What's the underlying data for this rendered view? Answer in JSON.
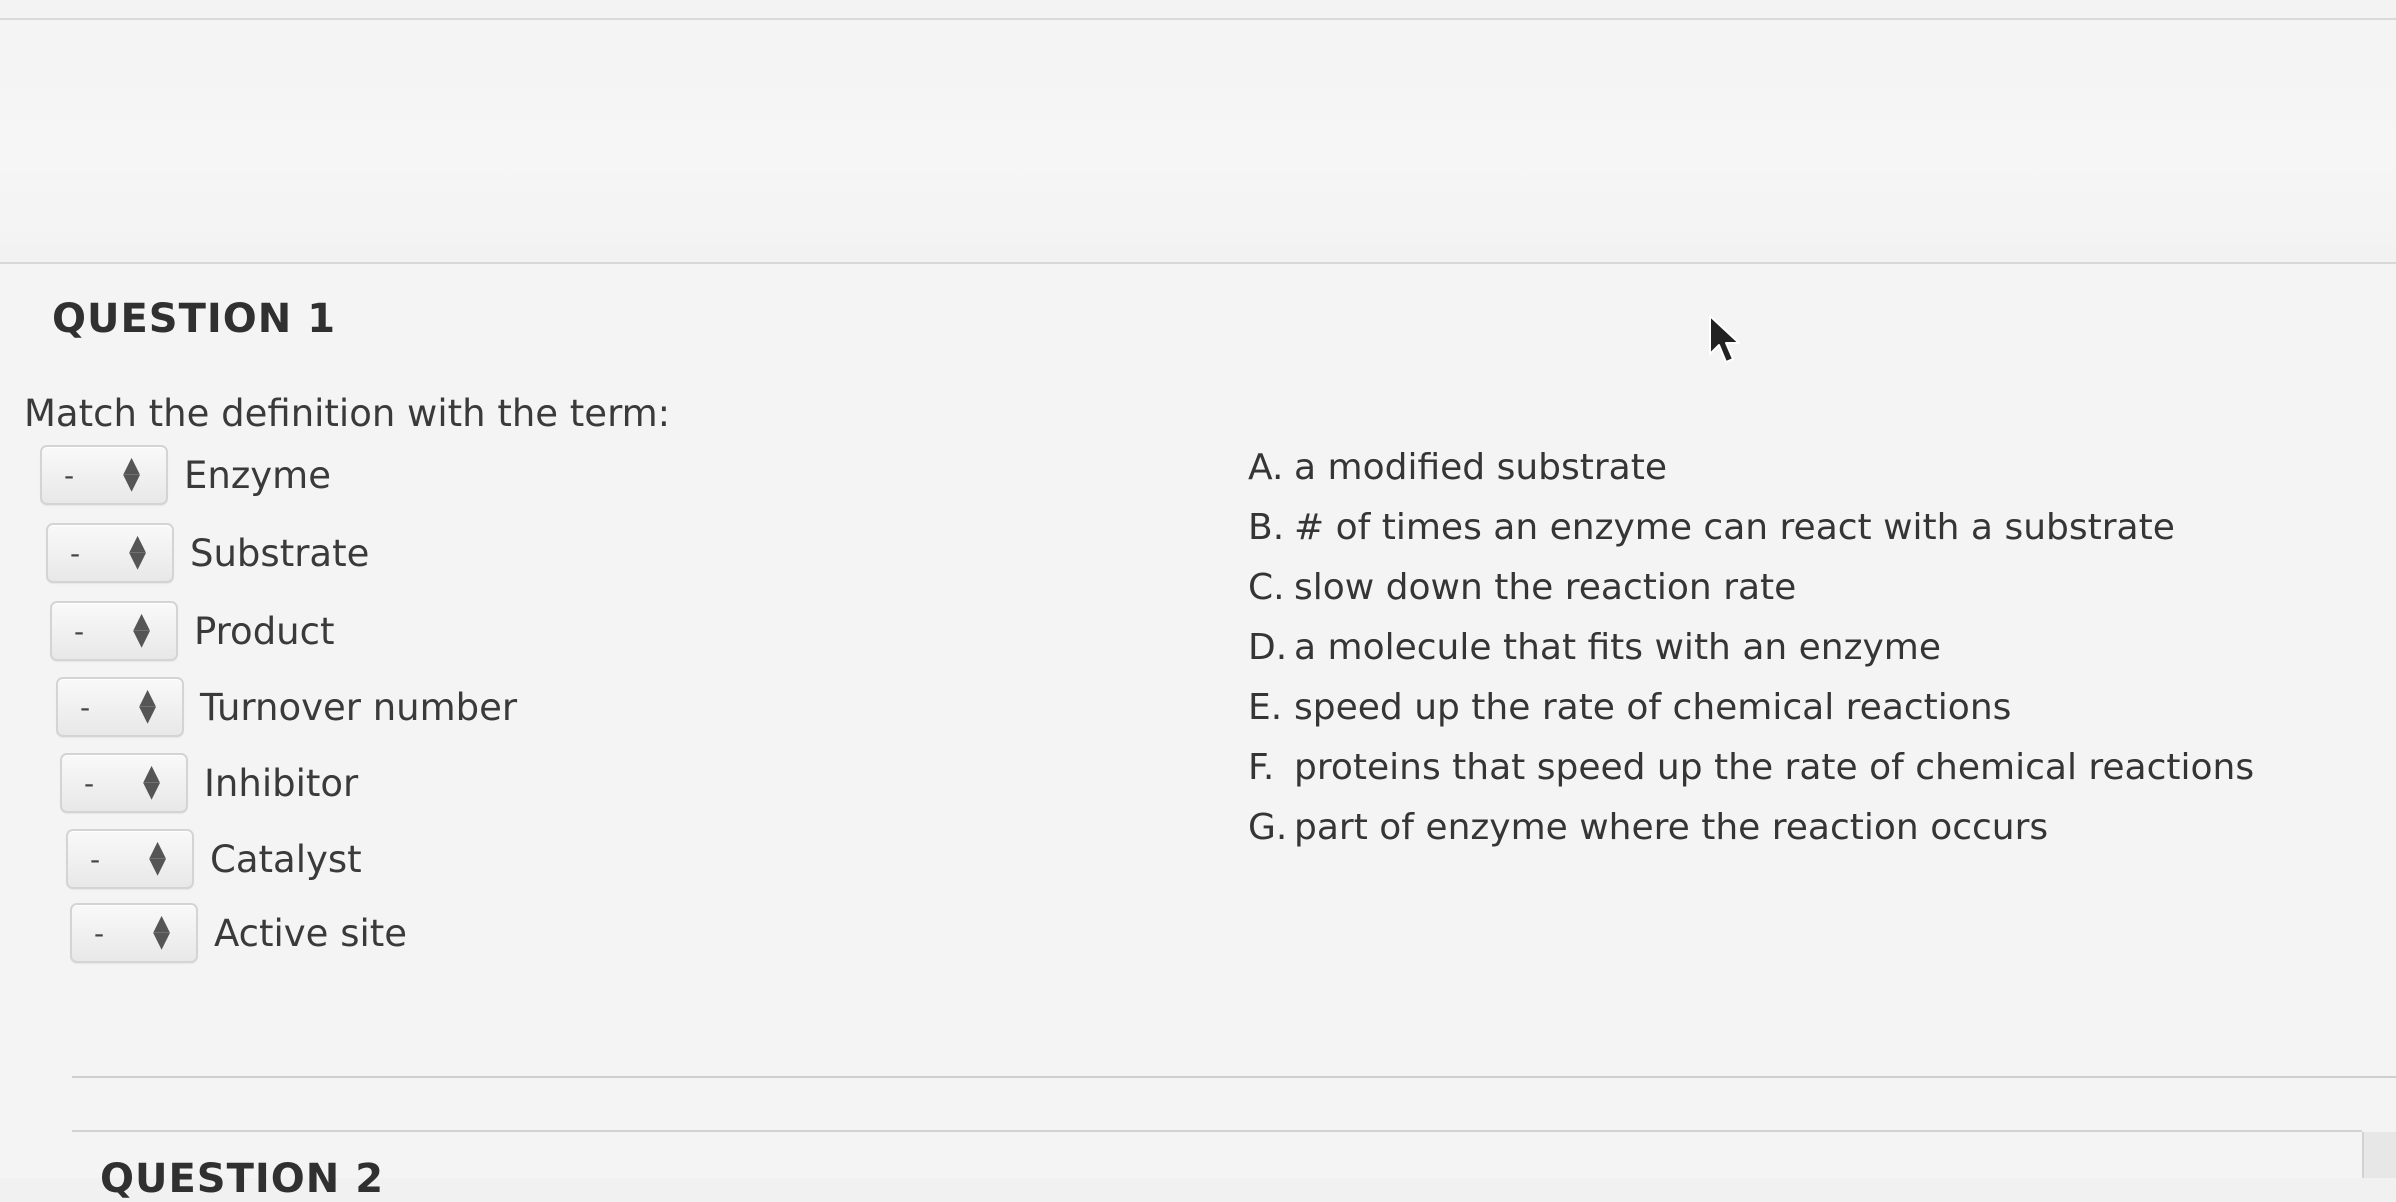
{
  "question": {
    "title": "QUESTION 1",
    "prompt": "Match the definition with the term:",
    "terms": [
      {
        "selected": "-",
        "label": "Enzyme"
      },
      {
        "selected": "-",
        "label": "Substrate"
      },
      {
        "selected": "-",
        "label": "Product"
      },
      {
        "selected": "-",
        "label": "Turnover number"
      },
      {
        "selected": "-",
        "label": "Inhibitor"
      },
      {
        "selected": "-",
        "label": "Catalyst"
      },
      {
        "selected": "-",
        "label": "Active site"
      }
    ],
    "options": [
      {
        "letter": "A.",
        "text": "a modified substrate"
      },
      {
        "letter": "B.",
        "text": "# of times an enzyme can react with a substrate"
      },
      {
        "letter": "C.",
        "text": "slow down the reaction rate"
      },
      {
        "letter": "D.",
        "text": "a molecule that fits with an enzyme"
      },
      {
        "letter": "E.",
        "text": "speed up the rate of chemical reactions"
      },
      {
        "letter": "F.",
        "text": "proteins that speed up the rate of chemical reactions"
      },
      {
        "letter": "G.",
        "text": "part of enzyme where the reaction occurs"
      }
    ]
  },
  "next_question": {
    "title": "QUESTION 2"
  },
  "icons": {
    "select_arrows": "up-down-arrows-icon",
    "cursor": "mouse-pointer-icon"
  },
  "colors": {
    "background": "#f4f4f4",
    "text": "#333333",
    "select_border": "#d4d4d4"
  }
}
